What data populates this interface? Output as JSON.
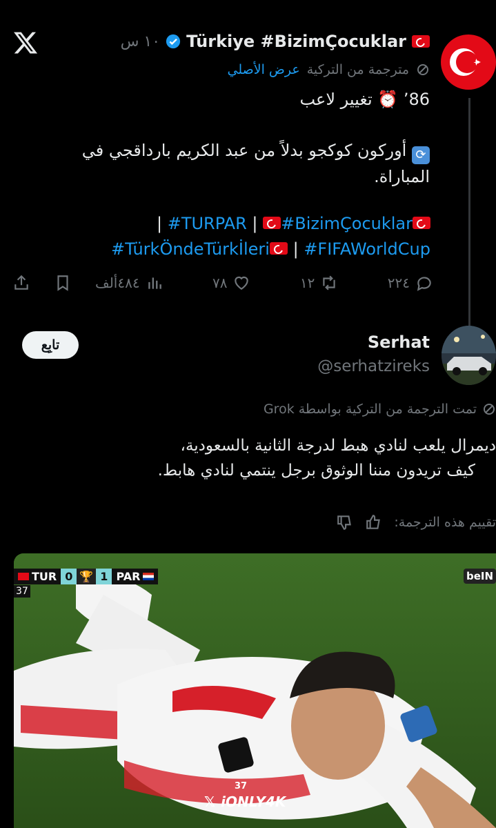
{
  "tweet": {
    "author_name": "Türkiye #BizimÇocuklar",
    "time_ago": "١٠ س",
    "translated_label": "مترجمة من التركية",
    "show_original_label": "عرض الأصلي",
    "line1_minute": "86’",
    "line1_text": "تغيير لاعب",
    "paragraph2": "أوركون كوكجو بدلاً من عبد الكريم بارداقجي في المباراة.",
    "hashtag_1": "#TURPAR",
    "hashtag_2": "#BizimÇocuklar",
    "hashtag_3": "#TürkÖndeTürkİleri",
    "hashtag_4": "#FIFAWorldCup",
    "separator": "|",
    "replies_count": "٢٢٤",
    "retweets_count": "١٢",
    "likes_count": "٧٨",
    "views_count": "٤٨٤ألف"
  },
  "reply": {
    "name": "Serhat",
    "handle": "@serhatzireks",
    "follow_label": "تابِع",
    "grok_label": "تمت الترجمة من التركية بواسطة Grok",
    "text_line1": "ديمرال يلعب لنادي هبط لدرجة الثانية بالسعودية،",
    "text_line2": "كيف تريدون مننا الوثوق برجل ينتمي لنادي هابط.",
    "rate_label": "تقييم هذه الترجمة:"
  },
  "photo": {
    "team_home": "TUR",
    "score_home": "0",
    "score_away": "1",
    "team_away": "PAR",
    "minute": "37",
    "channel": "beIN",
    "watermark": "iONLY4K",
    "jersey_number": "37"
  },
  "colors": {
    "accent": "#1d9bf0",
    "background": "#000000",
    "muted": "#71767b",
    "turkey_red": "#e30a17"
  },
  "icons": [
    "x-logo-icon",
    "verified-badge-icon",
    "turkey-flag-icon",
    "translate-icon",
    "alarm-clock-icon",
    "repeat-emoji-icon",
    "share-icon",
    "bookmark-icon",
    "views-icon",
    "like-icon",
    "retweet-icon",
    "reply-icon",
    "thumbs-up-icon",
    "thumbs-down-icon"
  ]
}
